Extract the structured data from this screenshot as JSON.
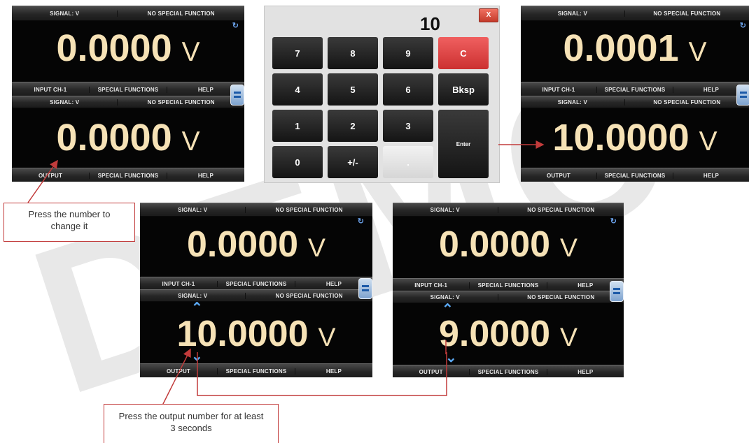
{
  "colors": {
    "reading": "#f6e2b6",
    "accent_red": "#c23b3b",
    "arrow_blue": "#5aa7f0"
  },
  "screen1": {
    "top_bar": [
      "SIGNAL: V",
      "NO SPECIAL FUNCTION"
    ],
    "input_value": "0.0000",
    "unit": "V",
    "mid_bar": [
      "INPUT CH-1",
      "SPECIAL FUNCTIONS",
      "HELP"
    ],
    "out_bar": [
      "SIGNAL: V",
      "NO SPECIAL FUNCTION"
    ],
    "output_value": "0.0000",
    "bottom_bar": [
      "OUTPUT",
      "SPECIAL FUNCTIONS",
      "HELP"
    ]
  },
  "keypad": {
    "display": "10",
    "close_label": "X",
    "keys": [
      "7",
      "8",
      "9",
      "C",
      "4",
      "5",
      "6",
      "Bksp",
      "1",
      "2",
      "3",
      "0",
      "+/-",
      "."
    ],
    "enter_label": "Enter"
  },
  "screen2": {
    "top_bar": [
      "SIGNAL: V",
      "NO SPECIAL FUNCTION"
    ],
    "input_value": "0.0001",
    "unit": "V",
    "mid_bar": [
      "INPUT CH-1",
      "SPECIAL FUNCTIONS",
      "HELP"
    ],
    "out_bar": [
      "SIGNAL: V",
      "NO SPECIAL FUNCTION"
    ],
    "output_value": "10.0000",
    "bottom_bar": [
      "OUTPUT",
      "SPECIAL FUNCTIONS",
      "HELP"
    ]
  },
  "screen3": {
    "top_bar": [
      "SIGNAL: V",
      "NO SPECIAL FUNCTION"
    ],
    "input_value": "0.0000",
    "unit": "V",
    "mid_bar": [
      "INPUT CH-1",
      "SPECIAL FUNCTIONS",
      "HELP"
    ],
    "out_bar": [
      "SIGNAL: V",
      "NO SPECIAL FUNCTION"
    ],
    "output_value": "10.0000",
    "bottom_bar": [
      "OUTPUT",
      "SPECIAL FUNCTIONS",
      "HELP"
    ]
  },
  "screen4": {
    "top_bar": [
      "SIGNAL: V",
      "NO SPECIAL FUNCTION"
    ],
    "input_value": "0.0000",
    "unit": "V",
    "mid_bar": [
      "INPUT CH-1",
      "SPECIAL FUNCTIONS",
      "HELP"
    ],
    "out_bar": [
      "SIGNAL: V",
      "NO SPECIAL FUNCTION"
    ],
    "output_value": "9.0000",
    "bottom_bar": [
      "OUTPUT",
      "SPECIAL FUNCTIONS",
      "HELP"
    ]
  },
  "callouts": {
    "press_number": "Press the number to change it",
    "press_output": "Press the output number for at least 3 seconds"
  },
  "icons": {
    "refresh": "refresh-icon",
    "menu": "menu-icon",
    "up": "chevron-up-icon",
    "down": "chevron-down-icon"
  }
}
